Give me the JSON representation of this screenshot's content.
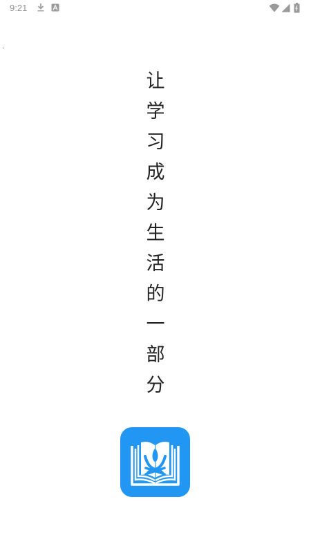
{
  "status_bar": {
    "time": "9:21",
    "icons": [
      "download-icon",
      "a-icon",
      "wifi-icon",
      "signal-icon",
      "battery-icon"
    ]
  },
  "splash": {
    "slogan_chars": [
      "让",
      "学",
      "习",
      "成",
      "为",
      "生",
      "活",
      "的",
      "一",
      "部",
      "分"
    ],
    "logo_icon": "open-book-logo-icon"
  },
  "colors": {
    "logo_background": "#2196f3",
    "logo_foreground": "#ffffff",
    "text": "#222222",
    "status_bar_text": "#8f8f8f",
    "background": "#ffffff"
  }
}
